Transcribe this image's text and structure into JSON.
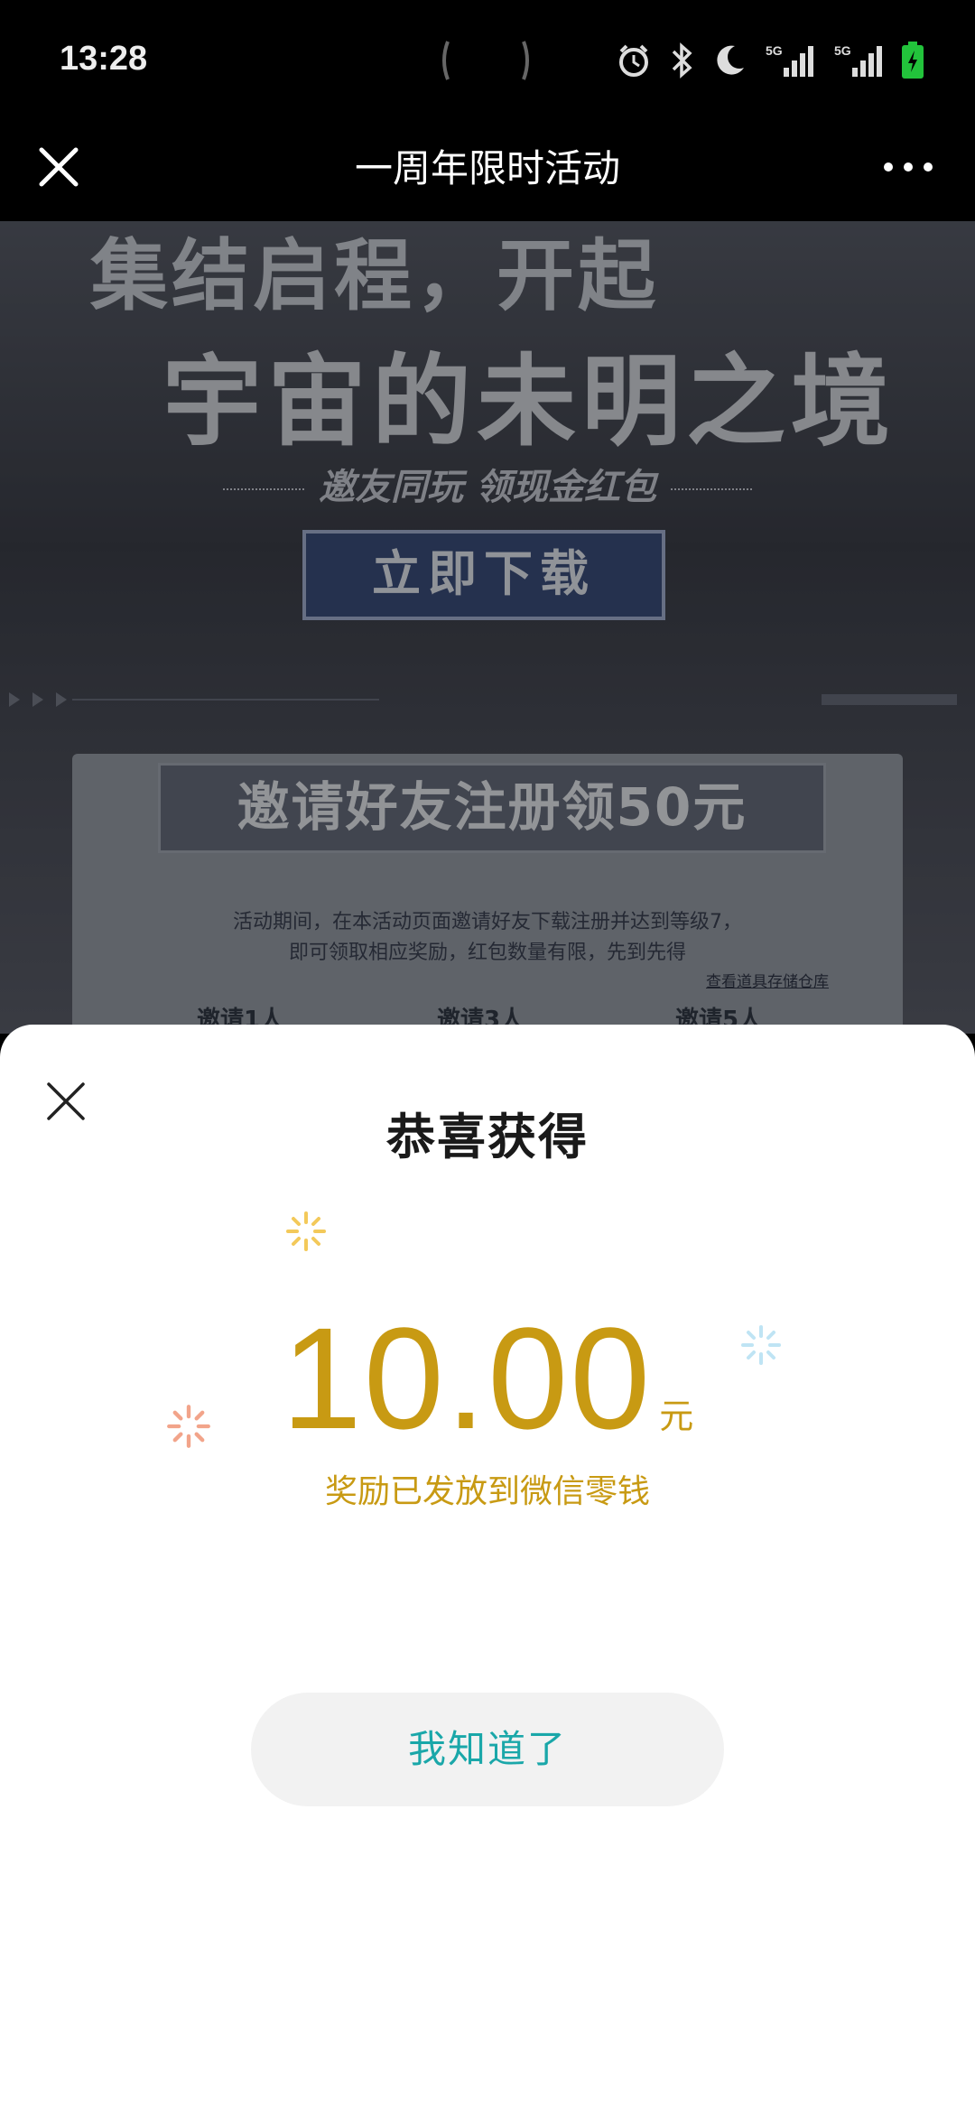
{
  "status_bar": {
    "time": "13:28",
    "icons": [
      "alarm-icon",
      "bluetooth-icon",
      "moon-icon",
      "signal-5g-icon",
      "signal-5g-icon",
      "battery-charging-icon"
    ]
  },
  "nav": {
    "title": "一周年限时活动"
  },
  "background_page": {
    "hero_line1": "集结启程，开起",
    "hero_line2": "宇宙的未明之境",
    "hero_subtitle": "邀友同玩 领现金红包",
    "download_label": "立即下载",
    "invite_title": "邀请好友注册领50元",
    "invite_desc_line1": "活动期间，在本活动页面邀请好友下载注册并达到等级7，",
    "invite_desc_line2": "即可领取相应奖励，红包数量有限，先到先得",
    "storage_link": "查看道具存储仓库",
    "tiers": [
      "邀请1人",
      "邀请3人",
      "邀请5人"
    ]
  },
  "reward_sheet": {
    "title": "恭喜获得",
    "amount": "10.00",
    "unit": "元",
    "note": "奖励已发放到微信零钱",
    "confirm_label": "我知道了"
  },
  "colors": {
    "amount": "#c89a13",
    "confirm_text": "#1aa7a9",
    "battery": "#22c33b"
  }
}
